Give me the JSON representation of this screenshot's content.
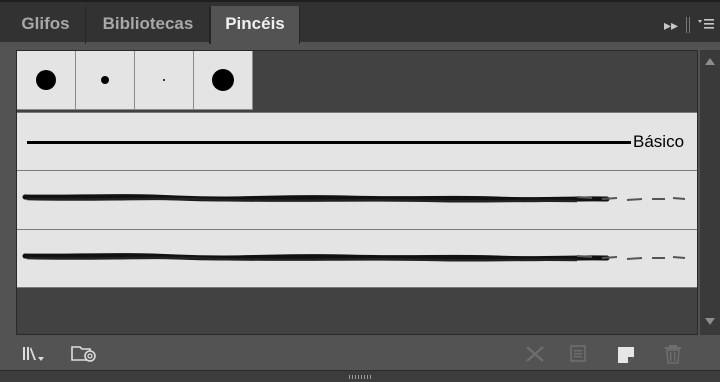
{
  "tabs": [
    {
      "label": "Glifos",
      "active": false
    },
    {
      "label": "Bibliotecas",
      "active": false
    },
    {
      "label": "Pincéis",
      "active": true
    }
  ],
  "tabbar_icons": [
    "collapse-icon",
    "panel-menu-icon"
  ],
  "brushes": {
    "calligraphic": [
      {
        "name": "calligraphic-brush-large"
      },
      {
        "name": "calligraphic-brush-medium"
      },
      {
        "name": "calligraphic-brush-small"
      },
      {
        "name": "calligraphic-brush-xlarge"
      }
    ],
    "basic_label": "Básico",
    "art_brushes": [
      "charcoal-brush",
      "charcoal-brush"
    ]
  },
  "toolbar_icons": [
    "brush-libraries-menu-icon",
    "libraries-panel-icon",
    "remove-brush-stroke-icon",
    "brush-options-icon",
    "new-brush-icon",
    "delete-brush-icon"
  ],
  "colors": {
    "panel": "#535353",
    "tabbar": "#323232",
    "swatch_bg": "#e4e4e4"
  }
}
